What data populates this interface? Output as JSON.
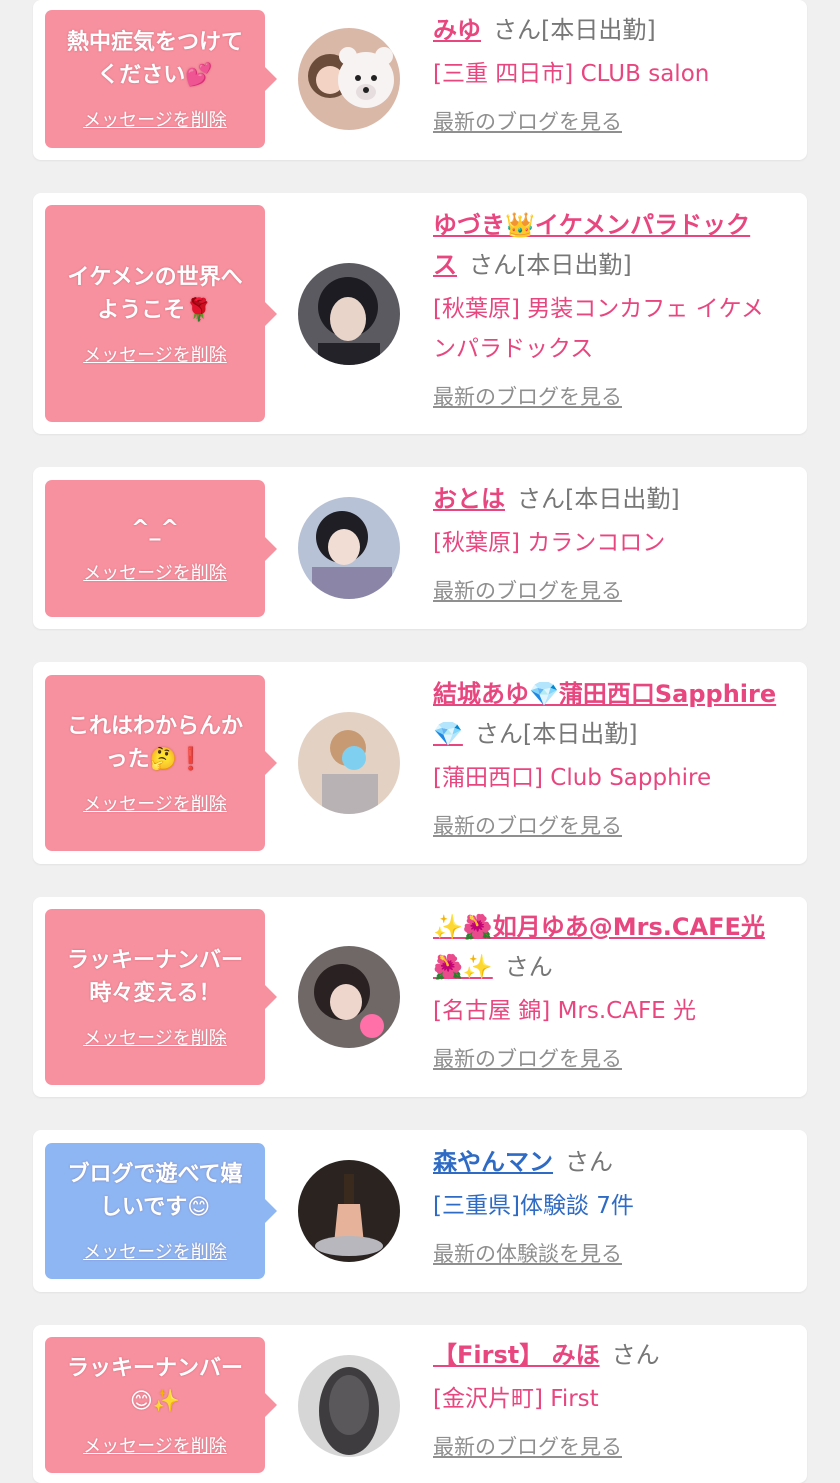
{
  "cards": [
    {
      "message_line1": "熱中症気をつけて",
      "message_line2": "ください💕",
      "delete_label": "メッセージを削除",
      "name": "みゆ",
      "honorific": "さん[本日出勤]",
      "shop": "[三重 四日市] CLUB salon",
      "more_label": "最新のブログを見る",
      "theme": "pink"
    },
    {
      "message_line1": "イケメンの世界へ",
      "message_line2": "ようこそ🌹",
      "delete_label": "メッセージを削除",
      "name": "ゆづき👑イケメンパラドック",
      "name_line2": "ス",
      "honorific": "さん[本日出勤]",
      "shop": "[秋葉原] 男装コンカフェ イケメ",
      "shop_line2": "ンパラドックス",
      "more_label": "最新のブログを見る",
      "theme": "pink"
    },
    {
      "message_line1": "^_^",
      "message_line2": "",
      "delete_label": "メッセージを削除",
      "name": "おとは",
      "honorific": "さん[本日出勤]",
      "shop": "[秋葉原] カランコロン",
      "more_label": "最新のブログを見る",
      "theme": "pink"
    },
    {
      "message_line1": "これはわからんか",
      "message_line2": "った🤔❗",
      "delete_label": "メッセージを削除",
      "name": "結城あゆ💎蒲田西口Sapphire",
      "name_line2": "💎",
      "honorific": "さん[本日出勤]",
      "shop": "[蒲田西口] Club Sapphire",
      "more_label": "最新のブログを見る",
      "theme": "pink"
    },
    {
      "message_line1": "ラッキーナンバー",
      "message_line2": "時々変える！",
      "delete_label": "メッセージを削除",
      "name": "✨🌺如月ゆあ@Mrs.CAFE光",
      "name_line2": "🌺✨",
      "honorific": "さん",
      "shop": "[名古屋 錦] Mrs.CAFE 光",
      "more_label": "最新のブログを見る",
      "theme": "pink"
    },
    {
      "message_line1": "ブログで遊べて嬉",
      "message_line2": "しいです😊",
      "delete_label": "メッセージを削除",
      "name": "森やんマン",
      "honorific": "さん",
      "shop": "[三重県]体験談 7件",
      "more_label": "最新の体験談を見る",
      "theme": "blue"
    },
    {
      "message_line1": "ラッキーナンバー",
      "message_line2": "😊✨",
      "delete_label": "メッセージを削除",
      "name": "【First】 みほ",
      "honorific": "さん",
      "shop": "[金沢片町] First",
      "more_label": "最新のブログを見る",
      "theme": "pink"
    }
  ],
  "colors": {
    "pink_bubble": "#f8919f",
    "blue_bubble": "#8eb6f3",
    "name_pink": "#e8467f",
    "name_blue": "#2f6bc4",
    "link_gray": "#8f8f8f"
  }
}
